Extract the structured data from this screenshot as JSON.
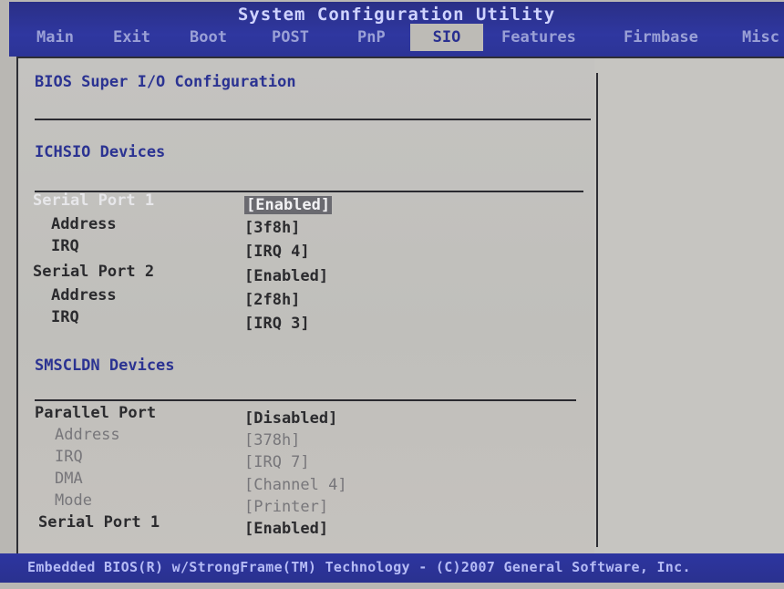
{
  "header": {
    "title": "System Configuration Utility",
    "tabs": [
      "Main",
      "Exit",
      "Boot",
      "POST",
      "PnP",
      "SIO",
      "Features",
      "Firmbase",
      "Misc"
    ],
    "active_tab": "SIO"
  },
  "panel": {
    "title": "BIOS Super I/O Configuration",
    "ichsio": {
      "heading": "ICHSIO Devices",
      "items": [
        {
          "label": "Serial Port 1",
          "value": "[Enabled]"
        },
        {
          "label": "Address",
          "value": "[3f8h]"
        },
        {
          "label": "IRQ",
          "value": "[IRQ 4]"
        },
        {
          "label": "Serial Port 2",
          "value": "[Enabled]"
        },
        {
          "label": "Address",
          "value": "[2f8h]"
        },
        {
          "label": "IRQ",
          "value": "[IRQ 3]"
        }
      ]
    },
    "smscldn": {
      "heading": "SMSCLDN Devices",
      "items": [
        {
          "label": "Parallel Port",
          "value": "[Disabled]"
        },
        {
          "label": "Address",
          "value": "[378h]"
        },
        {
          "label": "IRQ",
          "value": "[IRQ 7]"
        },
        {
          "label": "DMA",
          "value": "[Channel 4]"
        },
        {
          "label": "Mode",
          "value": "[Printer]"
        },
        {
          "label": "Serial Port 1",
          "value": "[Enabled]"
        }
      ]
    }
  },
  "footer": "Embedded BIOS(R) w/StrongFrame(TM) Technology - (C)2007 General Software, Inc.",
  "colors": {
    "bar": "#2c3496",
    "heading": "#2b3392",
    "panel": "#c2c1bd"
  }
}
